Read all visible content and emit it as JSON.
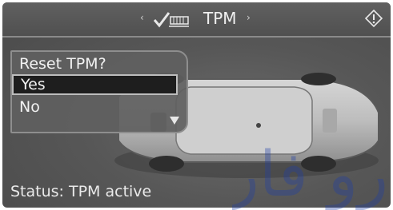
{
  "header": {
    "left_arrow": "‹",
    "right_arrow": "›",
    "icon": "tire-check-icon",
    "title": "TPM"
  },
  "menu": {
    "title": "Reset TPM?",
    "items": [
      {
        "label": "Yes",
        "selected": true
      },
      {
        "label": "No",
        "selected": false
      }
    ]
  },
  "status": {
    "text": "Status: TPM active"
  },
  "watermark": {
    "text": "رو فارا"
  },
  "colors": {
    "screen_bg": "#575757",
    "text": "#f2f2f2",
    "selection_bg": "#1e1e1e",
    "watermark": "#1f3fa8"
  }
}
